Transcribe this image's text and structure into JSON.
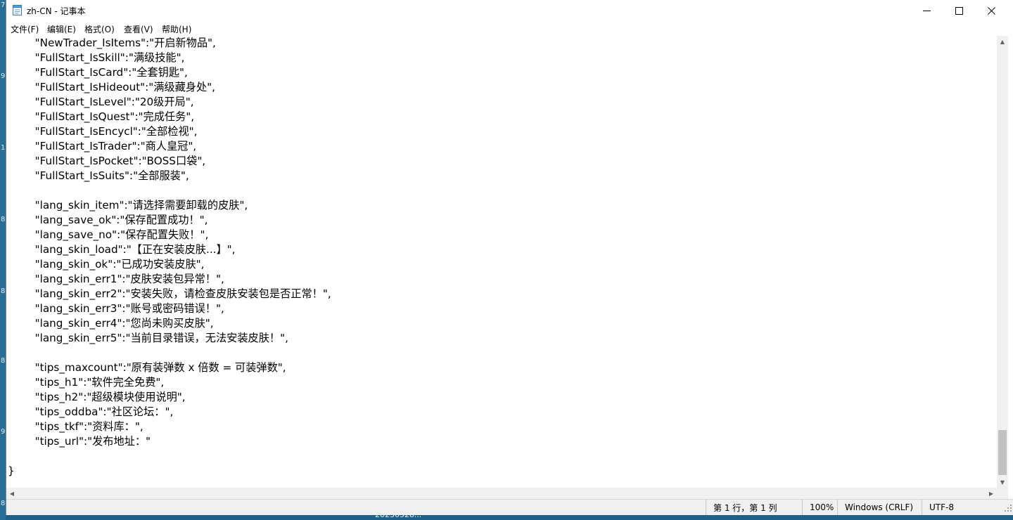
{
  "window": {
    "title": "zh-CN - 记事本",
    "controls": {
      "minimize": "minimize",
      "maximize": "maximize",
      "close": "close"
    }
  },
  "menu": [
    "文件(F)",
    "编辑(E)",
    "格式(O)",
    "查看(V)",
    "帮助(H)"
  ],
  "editor": {
    "lines": [
      "        \"NewTrader_IsItems\":\"开启新物品\",",
      "        \"FullStart_IsSkill\":\"满级技能\",",
      "        \"FullStart_IsCard\":\"全套钥匙\",",
      "        \"FullStart_IsHideout\":\"满级藏身处\",",
      "        \"FullStart_IsLevel\":\"20级开局\",",
      "        \"FullStart_IsQuest\":\"完成任务\",",
      "        \"FullStart_IsEncycl\":\"全部检视\",",
      "        \"FullStart_IsTrader\":\"商人皇冠\",",
      "        \"FullStart_IsPocket\":\"BOSS口袋\",",
      "        \"FullStart_IsSuits\":\"全部服装\",",
      "",
      "        \"lang_skin_item\":\"请选择需要卸载的皮肤\",",
      "        \"lang_save_ok\":\"保存配置成功！\",",
      "        \"lang_save_no\":\"保存配置失败！\",",
      "        \"lang_skin_load\":\"【正在安装皮肤...】\",",
      "        \"lang_skin_ok\":\"已成功安装皮肤\",",
      "        \"lang_skin_err1\":\"皮肤安装包异常！\",",
      "        \"lang_skin_err2\":\"安装失败，请检查皮肤安装包是否正常！\",",
      "        \"lang_skin_err3\":\"账号或密码错误！\",",
      "        \"lang_skin_err4\":\"您尚未购买皮肤\",",
      "        \"lang_skin_err5\":\"当前目录错误，无法安装皮肤！\",",
      "",
      "        \"tips_maxcount\":\"原有装弹数 x 倍数 = 可装弹数\",",
      "        \"tips_h1\":\"软件完全免费\",",
      "        \"tips_h2\":\"超级模块使用说明\",",
      "        \"tips_oddba\":\"社区论坛：\",",
      "        \"tips_tkf\":\"资料库：\",",
      "        \"tips_url\":\"发布地址：\"",
      "",
      "}"
    ]
  },
  "status": {
    "position": "第 1 行，第 1 列",
    "zoom": "100%",
    "line_ending": "Windows (CRLF)",
    "encoding": "UTF-8"
  },
  "desktop": {
    "edge_marks": [
      "7",
      "9",
      "1",
      "8",
      "8",
      "8",
      "9",
      "8"
    ],
    "taskbar_label": "2023052б..."
  },
  "colors": {
    "desktop": "#1f5f8a",
    "statusbar": "#f0f0f0",
    "scroll_thumb": "#c1c1c1"
  }
}
